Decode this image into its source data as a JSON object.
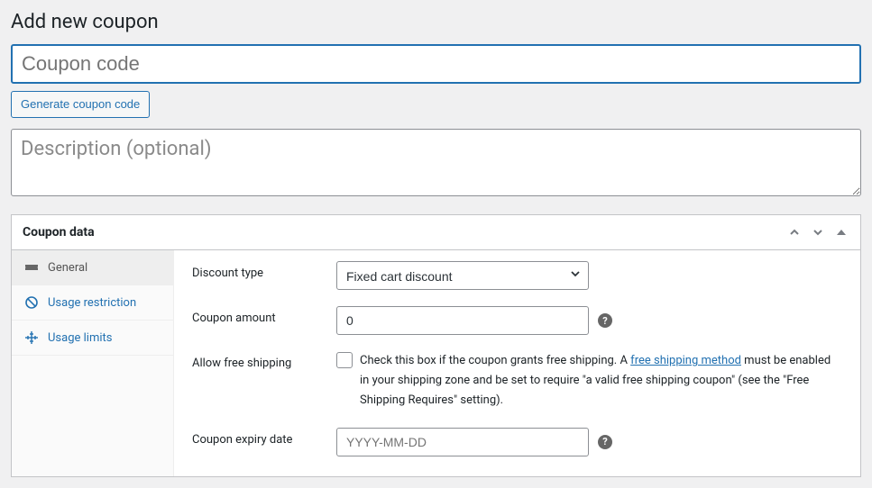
{
  "page_title": "Add new coupon",
  "coupon_code": {
    "placeholder": "Coupon code",
    "value": ""
  },
  "generate_button": "Generate coupon code",
  "description": {
    "placeholder": "Description (optional)",
    "value": ""
  },
  "panel": {
    "title": "Coupon data",
    "tabs": [
      {
        "label": "General",
        "active": true
      },
      {
        "label": "Usage restriction",
        "active": false
      },
      {
        "label": "Usage limits",
        "active": false
      }
    ]
  },
  "form": {
    "discount_type": {
      "label": "Discount type",
      "value": "Fixed cart discount"
    },
    "coupon_amount": {
      "label": "Coupon amount",
      "value": "0"
    },
    "free_shipping": {
      "label": "Allow free shipping",
      "desc_prefix": "Check this box if the coupon grants free shipping. A ",
      "link_text": "free shipping method",
      "desc_suffix": " must be enabled in your shipping zone and be set to require \"a valid free shipping coupon\" (see the \"Free Shipping Requires\" setting)."
    },
    "expiry_date": {
      "label": "Coupon expiry date",
      "placeholder": "YYYY-MM-DD",
      "value": ""
    }
  },
  "help_glyph": "?"
}
